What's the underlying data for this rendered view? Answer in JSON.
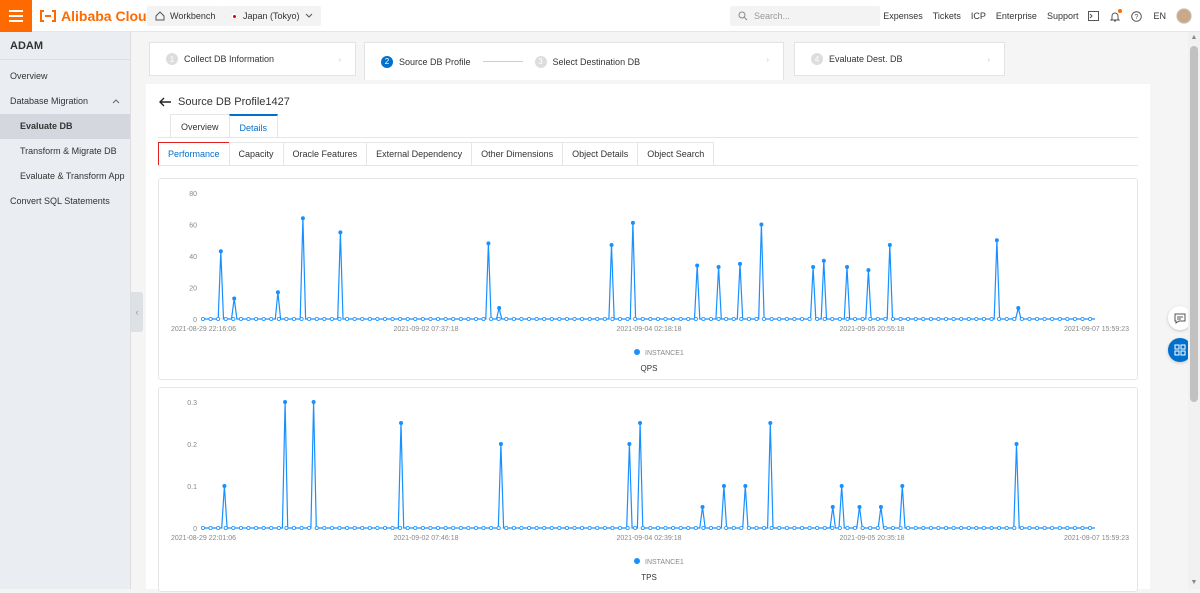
{
  "topbar": {
    "logo_text": "Alibaba Cloud",
    "workbench": "Workbench",
    "region": "Japan (Tokyo)",
    "search_placeholder": "Search...",
    "links": [
      "Expenses",
      "Tickets",
      "ICP",
      "Enterprise",
      "Support"
    ],
    "lang": "EN",
    "brand_color": "#ff6a00"
  },
  "sidebar": {
    "title": "ADAM",
    "items": [
      {
        "label": "Overview"
      },
      {
        "label": "Database Migration"
      },
      {
        "label": "Evaluate DB"
      },
      {
        "label": "Transform & Migrate DB"
      },
      {
        "label": "Evaluate & Transform App"
      },
      {
        "label": "Convert SQL Statements"
      }
    ]
  },
  "steps": {
    "s1": {
      "num": "1",
      "label": "Collect DB Information"
    },
    "s2": {
      "num": "2",
      "label": "Source DB Profile"
    },
    "s3": {
      "num": "3",
      "label": "Select Destination DB"
    },
    "s4": {
      "num": "4",
      "label": "Evaluate Dest. DB"
    }
  },
  "page": {
    "title": "Source DB Profile1427",
    "tabs": [
      "Overview",
      "Details"
    ],
    "subtabs": [
      "Performance",
      "Capacity",
      "Oracle Features",
      "External Dependency",
      "Other Dimensions",
      "Object Details",
      "Object Search"
    ]
  },
  "chart_data": [
    {
      "type": "line",
      "title": "QPS",
      "legend": "INSTANCE1",
      "legend_position": "bottom",
      "ylim": [
        0,
        80
      ],
      "yticks": [
        0,
        20,
        40,
        60,
        80
      ],
      "xticks": [
        "2021-08-29 22:16:06",
        "2021-09-02 07:37:18",
        "2021-09-04 02:18:18",
        "2021-09-05 20:55:18",
        "2021-09-07 15:59:23"
      ],
      "x_range": [
        0,
        100
      ],
      "grid": false,
      "color": "#1890ff",
      "peaks": [
        {
          "x": 2.0,
          "y": 43
        },
        {
          "x": 3.5,
          "y": 13
        },
        {
          "x": 8.4,
          "y": 17
        },
        {
          "x": 11.2,
          "y": 64
        },
        {
          "x": 15.4,
          "y": 55
        },
        {
          "x": 32.0,
          "y": 48
        },
        {
          "x": 33.2,
          "y": 7
        },
        {
          "x": 45.8,
          "y": 47
        },
        {
          "x": 48.2,
          "y": 61
        },
        {
          "x": 55.4,
          "y": 34
        },
        {
          "x": 57.8,
          "y": 33
        },
        {
          "x": 60.2,
          "y": 35
        },
        {
          "x": 62.6,
          "y": 60
        },
        {
          "x": 68.4,
          "y": 33
        },
        {
          "x": 69.6,
          "y": 37
        },
        {
          "x": 72.2,
          "y": 33
        },
        {
          "x": 74.6,
          "y": 31
        },
        {
          "x": 77.0,
          "y": 47
        },
        {
          "x": 89.0,
          "y": 50
        },
        {
          "x": 91.4,
          "y": 7
        }
      ]
    },
    {
      "type": "line",
      "title": "TPS",
      "legend": "INSTANCE1",
      "legend_position": "bottom",
      "ylim": [
        0,
        0.3
      ],
      "yticks": [
        "0",
        "0.1",
        "0.2",
        "0.3"
      ],
      "xticks": [
        "2021-08-29 22:01:06",
        "2021-09-02 07:46:18",
        "2021-09-04 02:39:18",
        "2021-09-05 20:35:18",
        "2021-09-07 15:59:23"
      ],
      "x_range": [
        0,
        100
      ],
      "grid": false,
      "color": "#1890ff",
      "peaks": [
        {
          "x": 2.4,
          "y": 0.1
        },
        {
          "x": 9.2,
          "y": 0.3
        },
        {
          "x": 12.4,
          "y": 0.3
        },
        {
          "x": 22.2,
          "y": 0.25
        },
        {
          "x": 33.4,
          "y": 0.2
        },
        {
          "x": 47.8,
          "y": 0.2
        },
        {
          "x": 49.0,
          "y": 0.25
        },
        {
          "x": 56.0,
          "y": 0.05
        },
        {
          "x": 58.4,
          "y": 0.1
        },
        {
          "x": 60.8,
          "y": 0.1
        },
        {
          "x": 63.6,
          "y": 0.25
        },
        {
          "x": 70.6,
          "y": 0.05
        },
        {
          "x": 71.6,
          "y": 0.1
        },
        {
          "x": 73.6,
          "y": 0.05
        },
        {
          "x": 76.0,
          "y": 0.05
        },
        {
          "x": 78.4,
          "y": 0.1
        },
        {
          "x": 91.2,
          "y": 0.2
        }
      ]
    }
  ]
}
